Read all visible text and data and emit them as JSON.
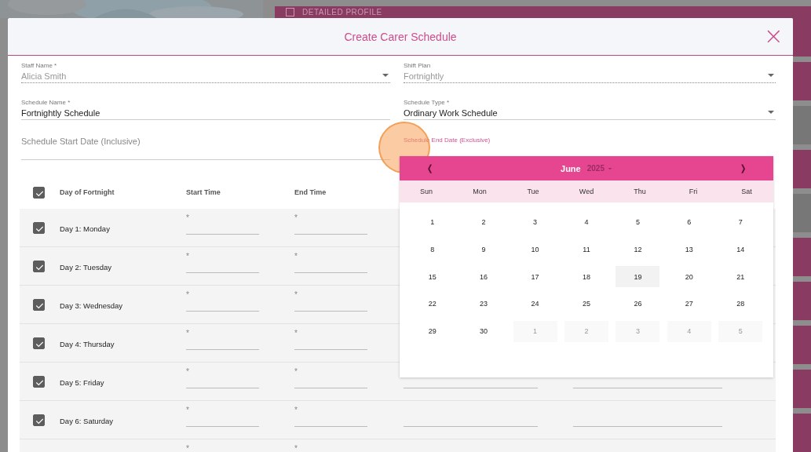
{
  "background": {
    "banner": "DETAILED PROFILE"
  },
  "dialog": {
    "title": "Create Carer Schedule",
    "close": "×"
  },
  "fields": [
    {
      "kind": "select",
      "label": "Staff Name *",
      "value": "Alicia Smith",
      "disabled": true,
      "focused": false
    },
    {
      "kind": "select",
      "label": "Shift Plan",
      "value": "Fortnightly",
      "disabled": true,
      "focused": false
    },
    {
      "kind": "text",
      "label": "Schedule Name *",
      "value": "Fortnightly Schedule",
      "disabled": false,
      "focused": false
    },
    {
      "kind": "select",
      "label": "Schedule Type *",
      "value": "Ordinary Work Schedule",
      "disabled": false,
      "focused": false
    },
    {
      "kind": "date",
      "placeholder": "Schedule Start Date (Inclusive)",
      "disabled": false,
      "focused": false
    },
    {
      "kind": "date",
      "label": "Schedule End Date (Exclusive)",
      "disabled": false,
      "focused": true
    }
  ],
  "table": {
    "select_all": {
      "checked": true
    },
    "columns": [
      "Day of Fortnight",
      "Start Time",
      "End Time"
    ],
    "rows": [
      {
        "kind": "covered",
        "day": "Day 1: Monday",
        "checked": true,
        "start": "*",
        "end": "*"
      },
      {
        "kind": "covered",
        "day": "Day 2: Tuesday",
        "checked": true,
        "start": "*",
        "end": "*"
      },
      {
        "kind": "covered",
        "day": "Day 3: Wednesday",
        "checked": true,
        "start": "*",
        "end": "*"
      },
      {
        "kind": "covered",
        "day": "Day 4: Thursday",
        "checked": true,
        "start": "*",
        "end": "*"
      },
      {
        "kind": "full",
        "day": "Day 5: Friday",
        "checked": true,
        "start": "*",
        "end": "*"
      },
      {
        "kind": "full",
        "day": "Day 6: Saturday",
        "checked": true,
        "start": "*",
        "end": "*"
      },
      {
        "kind": "covered",
        "start": "*",
        "end": "*"
      }
    ]
  },
  "calendar": {
    "prev": "❬",
    "next": "❭",
    "month": "June",
    "year": "2025",
    "weekdays": [
      "Sun",
      "Mon",
      "Tue",
      "Wed",
      "Thu",
      "Fri",
      "Sat"
    ],
    "weeks": [
      [
        {
          "day": "1",
          "today": false,
          "outside": false
        },
        {
          "day": "2",
          "today": false,
          "outside": false
        },
        {
          "day": "3",
          "today": false,
          "outside": false
        },
        {
          "day": "4",
          "today": false,
          "outside": false
        },
        {
          "day": "5",
          "today": false,
          "outside": false
        },
        {
          "day": "6",
          "today": false,
          "outside": false
        },
        {
          "day": "7",
          "today": false,
          "outside": false
        }
      ],
      [
        {
          "day": "8",
          "today": false,
          "outside": false
        },
        {
          "day": "9",
          "today": false,
          "outside": false
        },
        {
          "day": "10",
          "today": false,
          "outside": false
        },
        {
          "day": "11",
          "today": false,
          "outside": false
        },
        {
          "day": "12",
          "today": false,
          "outside": false
        },
        {
          "day": "13",
          "today": false,
          "outside": false
        },
        {
          "day": "14",
          "today": false,
          "outside": false
        }
      ],
      [
        {
          "day": "15",
          "today": false,
          "outside": false
        },
        {
          "day": "16",
          "today": false,
          "outside": false
        },
        {
          "day": "17",
          "today": false,
          "outside": false
        },
        {
          "day": "18",
          "today": false,
          "outside": false
        },
        {
          "day": "19",
          "today": true,
          "outside": false
        },
        {
          "day": "20",
          "today": false,
          "outside": false
        },
        {
          "day": "21",
          "today": false,
          "outside": false
        }
      ],
      [
        {
          "day": "22",
          "today": false,
          "outside": false
        },
        {
          "day": "23",
          "today": false,
          "outside": false
        },
        {
          "day": "24",
          "today": false,
          "outside": false
        },
        {
          "day": "25",
          "today": false,
          "outside": false
        },
        {
          "day": "26",
          "today": false,
          "outside": false
        },
        {
          "day": "27",
          "today": false,
          "outside": false
        },
        {
          "day": "28",
          "today": false,
          "outside": false
        }
      ],
      [
        {
          "day": "29",
          "today": false,
          "outside": false
        },
        {
          "day": "30",
          "today": false,
          "outside": false
        },
        {
          "day": "1",
          "today": false,
          "outside": true
        },
        {
          "day": "2",
          "today": false,
          "outside": true
        },
        {
          "day": "3",
          "today": false,
          "outside": true
        },
        {
          "day": "4",
          "today": false,
          "outside": true
        },
        {
          "day": "5",
          "today": false,
          "outside": true
        }
      ]
    ]
  }
}
